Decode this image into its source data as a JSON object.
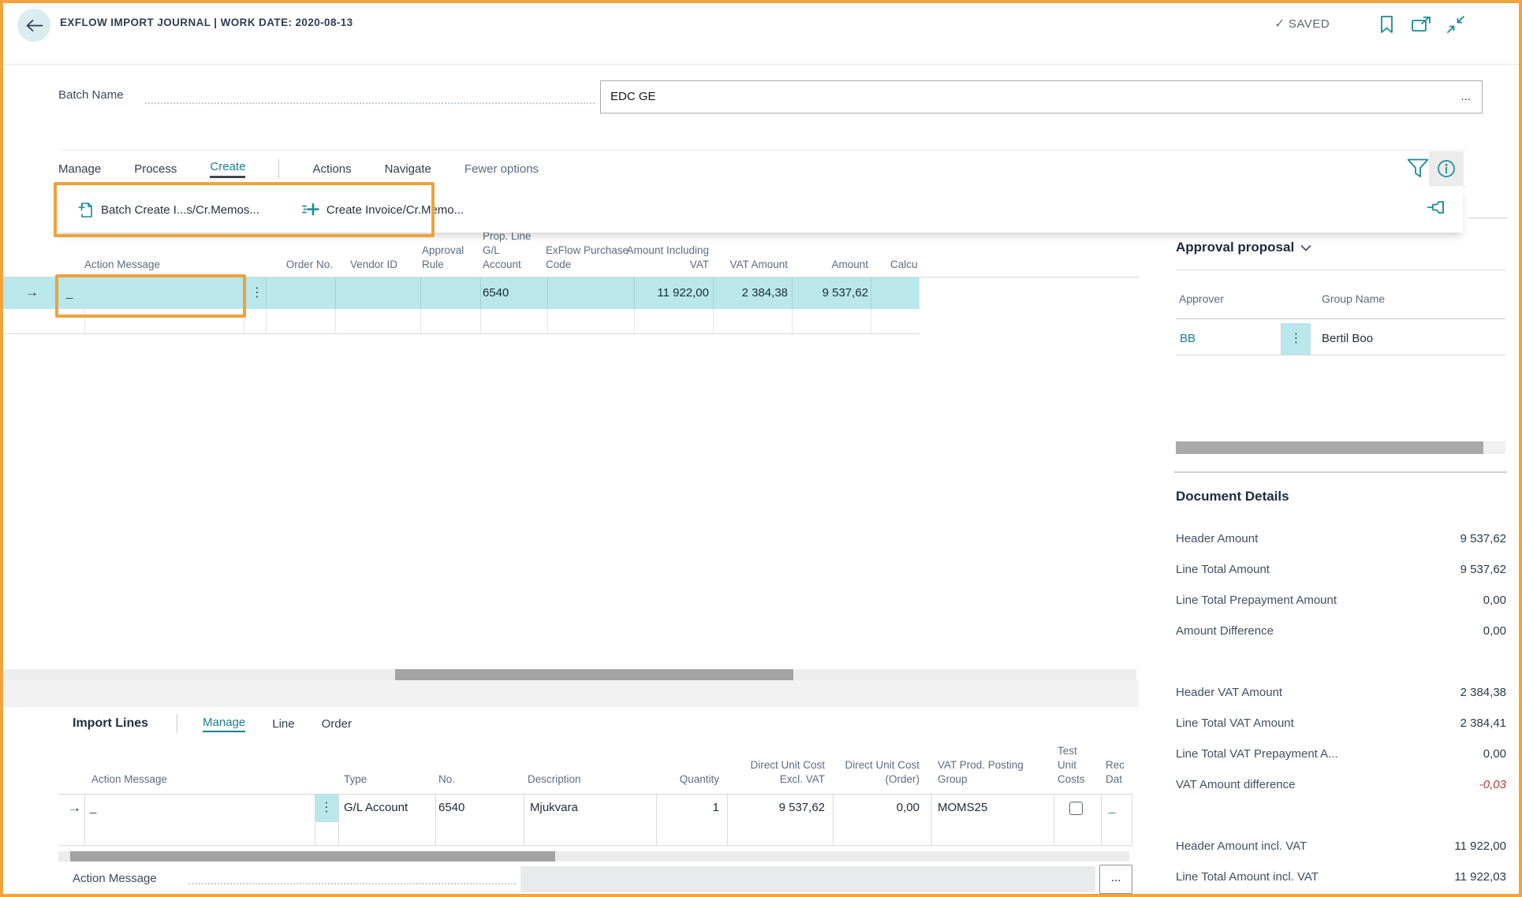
{
  "header": {
    "title": "EXFLOW IMPORT JOURNAL | WORK DATE: 2020-08-13",
    "saved": "SAVED"
  },
  "batch": {
    "label": "Batch Name",
    "value": "EDC GE",
    "assist": "..."
  },
  "toolbar": {
    "manage": "Manage",
    "process": "Process",
    "create": "Create",
    "actions": "Actions",
    "navigate": "Navigate",
    "fewer_options": "Fewer options"
  },
  "create_menu": {
    "batch_create": "Batch Create I...s/Cr.Memos...",
    "create_invoice": "Create Invoice/Cr.Memo..."
  },
  "journal": {
    "columns": {
      "action_message": "Action Message",
      "order_no": "Order No.",
      "vendor_id": "Vendor ID",
      "approval_rule": "Approval Rule",
      "prop_line_gl_account": "Prop. Line G/L Account",
      "exflow_purchase_code": "ExFlow Purchase Code",
      "amount_including_vat": "Amount Including VAT",
      "vat_amount": "VAT Amount",
      "amount": "Amount",
      "calc_clipped": "Calcu"
    },
    "row": {
      "cursor": "_",
      "gl_account": "6540",
      "amount_including_vat": "11 922,00",
      "vat_amount": "2 384,38",
      "amount": "9 537,62"
    }
  },
  "import_lines": {
    "title": "Import Lines",
    "tabs": {
      "manage": "Manage",
      "line": "Line",
      "order": "Order"
    },
    "columns": {
      "action_message": "Action Message",
      "type": "Type",
      "no": "No.",
      "description": "Description",
      "quantity": "Quantity",
      "direct_unit_cost_excl_vat": "Direct Unit Cost Excl. VAT",
      "direct_unit_cost_order": "Direct Unit Cost (Order)",
      "vat_prod_posting_group": "VAT Prod. Posting Group",
      "test_unit_costs": "Test Unit Costs",
      "rec_clipped": "Rec Dat"
    },
    "row": {
      "cursor": "_",
      "type": "G/L Account",
      "no": "6540",
      "description": "Mjukvara",
      "quantity": "1",
      "direct_unit_cost_excl_vat": "9 537,62",
      "direct_unit_cost_order": "0,00",
      "vat_prod_posting_group": "MOMS25",
      "rec_cursor": "_"
    },
    "footer": {
      "label": "Action Message",
      "assist": "..."
    }
  },
  "approval": {
    "title": "Approval proposal",
    "columns": {
      "approver": "Approver",
      "group_name": "Group Name"
    },
    "row": {
      "approver": "BB",
      "group_name": "Bertil Boo"
    }
  },
  "document_details": {
    "title": "Document Details",
    "rows": [
      {
        "label": "Header Amount",
        "value": "9 537,62"
      },
      {
        "label": "Line Total Amount",
        "value": "9 537,62"
      },
      {
        "label": "Line Total Prepayment Amount",
        "value": "0,00"
      },
      {
        "label": "Amount Difference",
        "value": "0,00"
      },
      {
        "label": "Header VAT Amount",
        "value": "2 384,38"
      },
      {
        "label": "Line Total VAT Amount",
        "value": "2 384,41"
      },
      {
        "label": "Line Total VAT Prepayment A...",
        "value": "0,00"
      },
      {
        "label": "VAT Amount difference",
        "value": "-0,03"
      },
      {
        "label": "Header Amount incl. VAT",
        "value": "11 922,00"
      },
      {
        "label": "Line Total Amount incl. VAT",
        "value": "11 922,03"
      }
    ]
  },
  "colors": {
    "accent_teal": "#1a8a98",
    "row_highlight": "#b9e7eb",
    "annotation_orange": "#eba33c",
    "negative_red": "#b8333c"
  }
}
